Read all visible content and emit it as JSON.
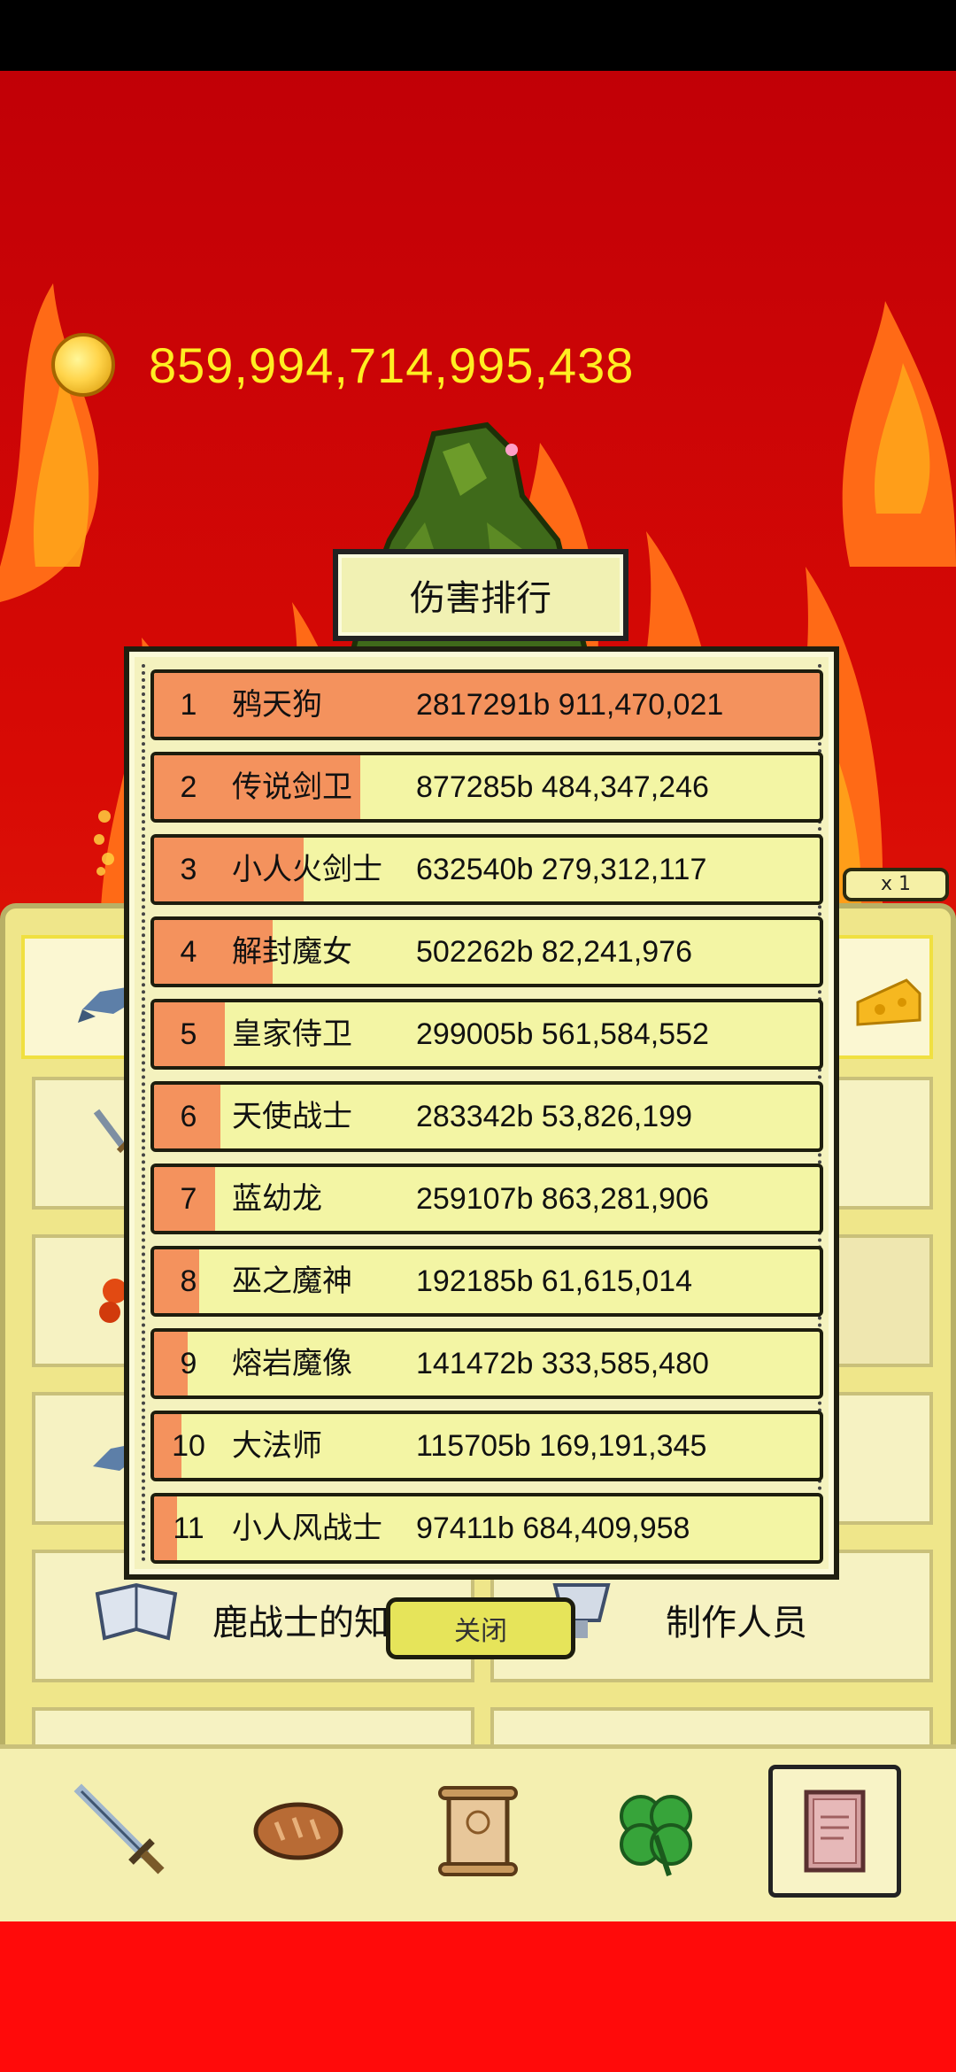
{
  "hud": {
    "gold_amount": "859,994,714,995,438",
    "multiplier": "x 1",
    "partial_left_digit": "8",
    "partial_right_digit": "8"
  },
  "background_tiles": {
    "knowledge_label": "鹿战士的知识",
    "credits_label": "制作人员"
  },
  "leaderboard": {
    "title": "伤害排行",
    "close_label": "关闭",
    "rows": [
      {
        "rank": "1",
        "name": "鸦天狗",
        "stats": "2817291b 911,470,021",
        "fill": 1.0
      },
      {
        "rank": "2",
        "name": "传说剑卫",
        "stats": "877285b 484,347,246",
        "fill": 0.31
      },
      {
        "rank": "3",
        "name": "小人火剑士",
        "stats": "632540b 279,312,117",
        "fill": 0.225
      },
      {
        "rank": "4",
        "name": "解封魔女",
        "stats": "502262b 82,241,976",
        "fill": 0.178
      },
      {
        "rank": "5",
        "name": "皇家侍卫",
        "stats": "299005b 561,584,552",
        "fill": 0.106
      },
      {
        "rank": "6",
        "name": "天使战士",
        "stats": "283342b 53,826,199",
        "fill": 0.1
      },
      {
        "rank": "7",
        "name": "蓝幼龙",
        "stats": "259107b 863,281,906",
        "fill": 0.092
      },
      {
        "rank": "8",
        "name": "巫之魔神",
        "stats": "192185b 61,615,014",
        "fill": 0.068
      },
      {
        "rank": "9",
        "name": "熔岩魔像",
        "stats": "141472b 333,585,480",
        "fill": 0.05
      },
      {
        "rank": "10",
        "name": "大法师",
        "stats": "115705b 169,191,345",
        "fill": 0.041
      },
      {
        "rank": "11",
        "name": "小人风战士",
        "stats": "97411b 684,409,958",
        "fill": 0.035
      }
    ]
  },
  "bottom_nav": {
    "items": [
      "sword-icon",
      "bread-icon",
      "scroll-icon",
      "clover-icon",
      "book-icon"
    ],
    "active": "book-icon"
  },
  "colors": {
    "gold_text": "#ffee22",
    "bar_fill": "#f4925d",
    "row_bg": "#f3f5a4",
    "panel_bg": "#f4f2be"
  }
}
